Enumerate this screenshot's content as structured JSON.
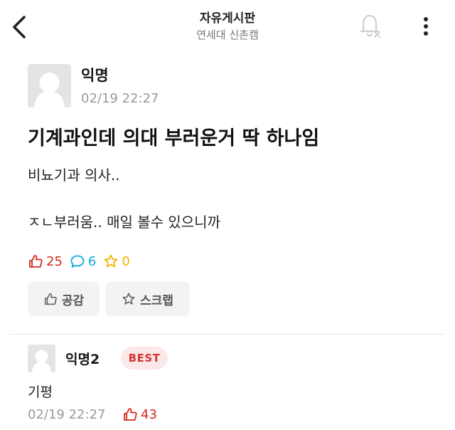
{
  "header": {
    "title": "자유게시판",
    "subtitle": "연세대 신촌캠",
    "back_icon": "chevron-left-icon",
    "notify_icon": "bell-off-icon",
    "more_icon": "vertical-dots-icon"
  },
  "post": {
    "author": "익명",
    "time": "02/19 22:27",
    "title": "기계과인데 의대 부러운거 딱 하나임",
    "body": "비뇨기과 의사..\n\nㅈㄴ부러움.. 매일 볼수 있으니까",
    "stats": {
      "likes": "25",
      "comments": "6",
      "scraps": "0"
    },
    "actions": {
      "like_label": "공감",
      "scrap_label": "스크랩"
    }
  },
  "comments": [
    {
      "author": "익명2",
      "badge": "BEST",
      "body": "기평",
      "time": "02/19 22:27",
      "likes": "43"
    }
  ],
  "colors": {
    "like": "#d72a1f",
    "comment": "#11a8d6",
    "scrap": "#f2b400",
    "best_badge_bg": "#fbe8e8",
    "best_badge_text": "#d73333",
    "muted": "#9a9a9a"
  }
}
